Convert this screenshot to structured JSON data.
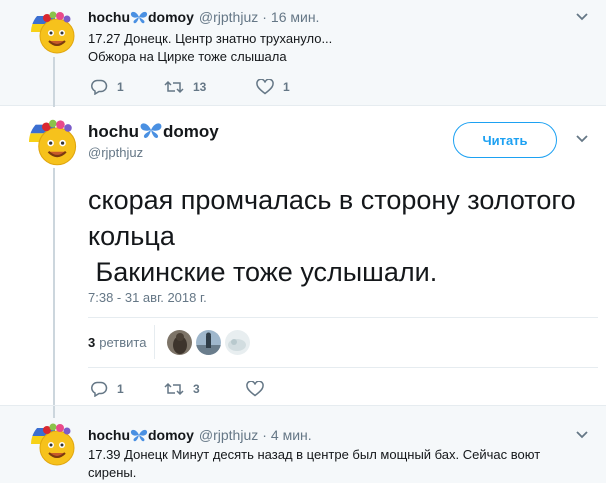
{
  "tweets": {
    "previous": {
      "display_name": "hochu",
      "display_name_suffix": "domoy",
      "handle": "@rjpthjuz",
      "time": "16 мин.",
      "text_line1": "17.27 Донецк. Центр знатно трухануло...",
      "text_line2": "Обжора на Цирке тоже слышала",
      "reply_count": "1",
      "retweet_count": "13",
      "like_count": "1"
    },
    "main": {
      "display_name": "hochu",
      "display_name_suffix": "domoy",
      "handle": "@rjpthjuz",
      "follow_label": "Читать",
      "text": "скорая промчалась в сторону золотого кольца\n Бакинские тоже услышали.",
      "date": "7:38 - 31 авг. 2018 г.",
      "retweets_count": "3",
      "retweets_label": "ретвита",
      "reply_count": "1",
      "retweet_count": "3"
    },
    "next": {
      "display_name": "hochu",
      "display_name_suffix": "domoy",
      "handle": "@rjpthjuz",
      "time": "4 мин.",
      "text_line1": "17.39 Донецк Минут десять назад в центре был мощный бах. Сейчас воют",
      "text_line2": "сирены."
    }
  },
  "colors": {
    "accent": "#1da1f2",
    "muted": "#657786",
    "background_alt": "#f5f8fa"
  }
}
